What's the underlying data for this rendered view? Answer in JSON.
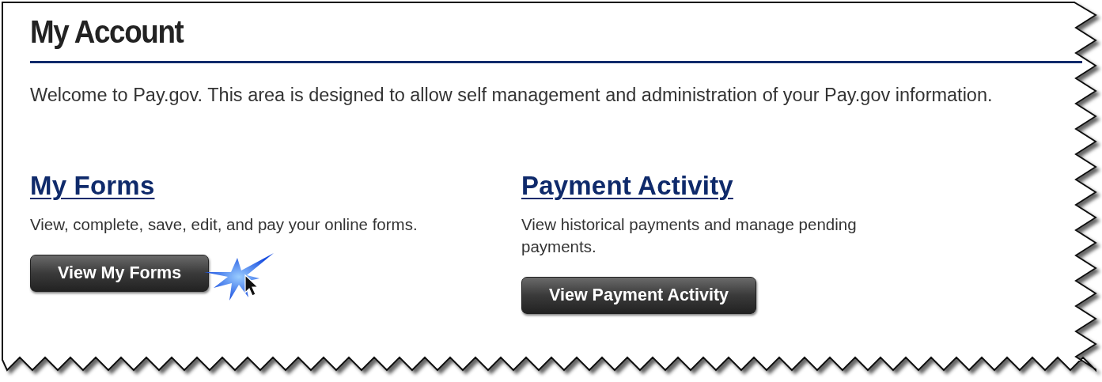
{
  "title": "My Account",
  "intro": "Welcome to Pay.gov. This area is designed to allow self management and administration of your Pay.gov information.",
  "sections": [
    {
      "heading": "My Forms",
      "description": "View, complete, save, edit, and pay your online forms.",
      "button": "View My Forms",
      "clicked": true
    },
    {
      "heading": "Payment Activity",
      "description": "View historical payments and manage pending payments.",
      "button": "View Payment Activity",
      "clicked": false
    }
  ]
}
